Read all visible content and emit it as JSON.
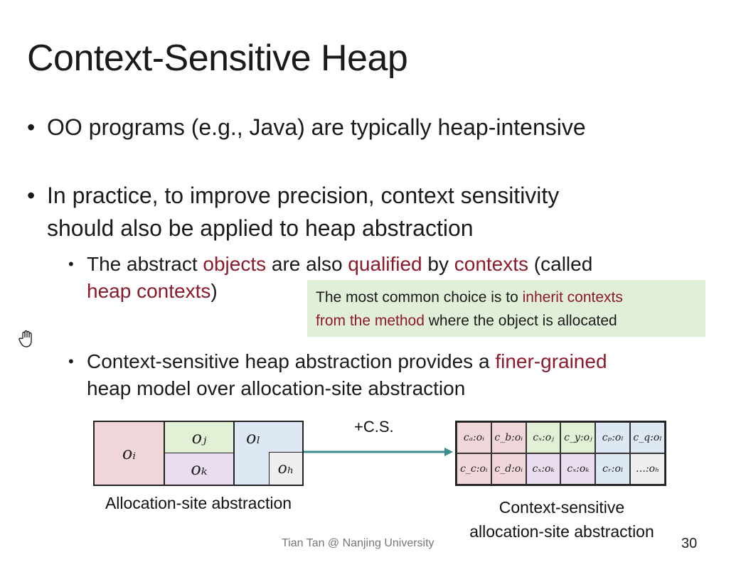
{
  "title": "Context-Sensitive Heap",
  "bullets": {
    "b1": "OO programs (e.g., Java) are typically heap-intensive",
    "b2_line1": "In practice, to improve precision, context sensitivity",
    "b2_line2": "should also be applied to heap abstraction"
  },
  "sub1": {
    "p1": "The abstract ",
    "objects": "objects",
    "p2": " are also ",
    "qualified": "qualified",
    "p3": " by ",
    "contexts": "contexts",
    "p4": " (called",
    "heap_contexts": "heap contexts",
    "p5": ")"
  },
  "note": {
    "p1": "The most common choice is to ",
    "red1": "inherit contexts",
    "red2": "from the method",
    "p2": " where the object is allocated"
  },
  "sub2": {
    "p1": "Context-sensitive heap abstraction provides a ",
    "red": "finer-grained",
    "p2": "heap model over allocation-site abstraction"
  },
  "diagram": {
    "alloc_cells": {
      "oi": "oᵢ",
      "oj": "oⱼ",
      "ok": "oₖ",
      "ol": "oₗ",
      "oh": "oₕ"
    },
    "alloc_label": "Allocation-site abstraction",
    "arrow_label": "+C.S.",
    "cs_cells": [
      {
        "text": "cₐ:oᵢ",
        "color": "#f2d7da"
      },
      {
        "text": "c_b:oᵢ",
        "color": "#f2d7da"
      },
      {
        "text": "cₓ:oⱼ",
        "color": "#e2f0d6"
      },
      {
        "text": "c_y:oⱼ",
        "color": "#e2f0d6"
      },
      {
        "text": "cₚ:oₗ",
        "color": "#dde8f4"
      },
      {
        "text": "c_q:oₗ",
        "color": "#dde8f4"
      },
      {
        "text": "c_c:oᵢ",
        "color": "#f2d7da"
      },
      {
        "text": "c_d:oᵢ",
        "color": "#f2d7da"
      },
      {
        "text": "cₓ:oₖ",
        "color": "#eaddf0"
      },
      {
        "text": "cₓ:oₖ",
        "color": "#eaddf0"
      },
      {
        "text": "cᵣ:oₗ",
        "color": "#dde8f4"
      },
      {
        "text": "…:oₕ",
        "color": "#efefef"
      }
    ],
    "cs_label_line1": "Context-sensitive",
    "cs_label_line2": "allocation-site abstraction"
  },
  "footer": "Tian Tan @ Nanjing University",
  "page_number": "30",
  "colors": {
    "accent_red": "#8b1a2b",
    "note_bg": "#e2efd8",
    "arrow": "#3c8c8c"
  }
}
